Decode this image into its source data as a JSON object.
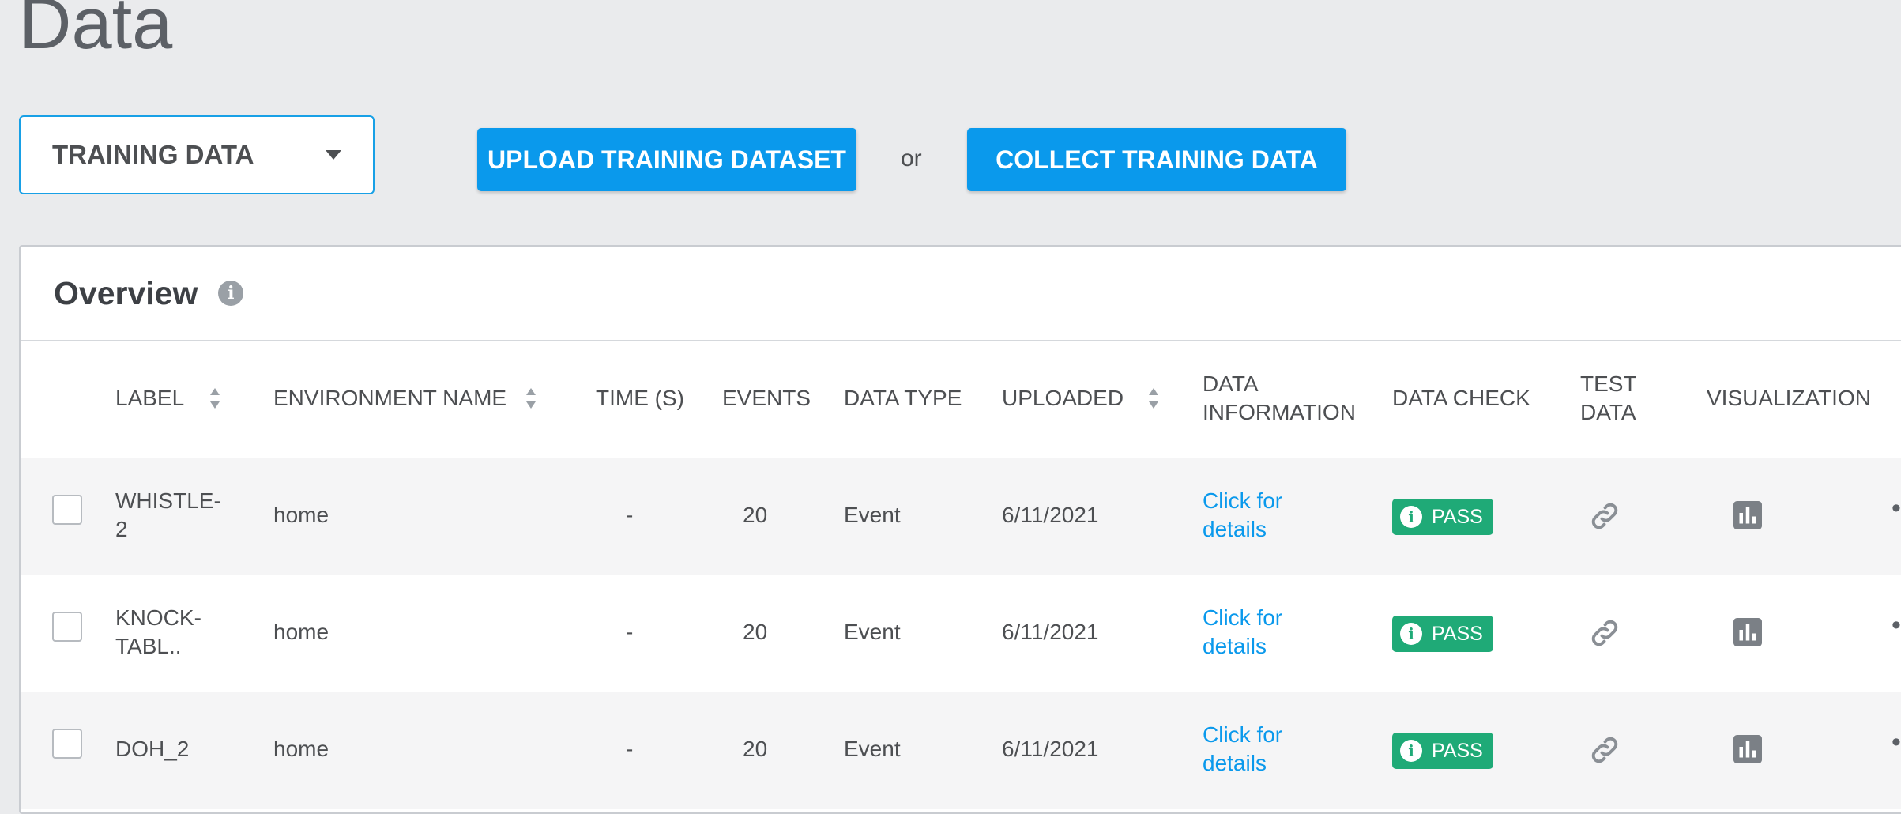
{
  "page": {
    "title": "Data"
  },
  "toolbar": {
    "dataset_selected": "TRAINING DATA",
    "upload_label": "UPLOAD TRAINING DATASET",
    "or_label": "or",
    "collect_label": "COLLECT TRAINING DATA"
  },
  "overview": {
    "title": "Overview"
  },
  "table": {
    "headers": {
      "label": "LABEL",
      "environment": "ENVIRONMENT NAME",
      "time": "TIME (S)",
      "events": "EVENTS",
      "data_type": "DATA TYPE",
      "uploaded": "UPLOADED",
      "data_info_1": "DATA",
      "data_info_2": "INFORMATION",
      "data_check": "DATA CHECK",
      "test_data_1": "TEST",
      "test_data_2": "DATA",
      "visualization": "VISUALIZATION"
    },
    "rows": [
      {
        "label_1": "WHISTLE-",
        "label_2": "2",
        "environment": "home",
        "time": "-",
        "events": "20",
        "data_type": "Event",
        "uploaded": "6/11/2021",
        "info_1": "Click for",
        "info_2": "details",
        "check": "PASS"
      },
      {
        "label_1": "KNOCK-",
        "label_2": "TABL..",
        "environment": "home",
        "time": "-",
        "events": "20",
        "data_type": "Event",
        "uploaded": "6/11/2021",
        "info_1": "Click for",
        "info_2": "details",
        "check": "PASS"
      },
      {
        "label_1": "DOH_2",
        "label_2": "",
        "environment": "home",
        "time": "-",
        "events": "20",
        "data_type": "Event",
        "uploaded": "6/11/2021",
        "info_1": "Click for",
        "info_2": "details",
        "check": "PASS"
      }
    ]
  },
  "icons": {
    "sort": "sort-icon",
    "info": "info-icon",
    "link": "link-icon",
    "chart": "bar-chart-icon",
    "more": "more-icon",
    "caret": "chevron-down-icon"
  },
  "colors": {
    "accent": "#0a99ec",
    "pass": "#1faa77",
    "background": "#eaebed"
  }
}
